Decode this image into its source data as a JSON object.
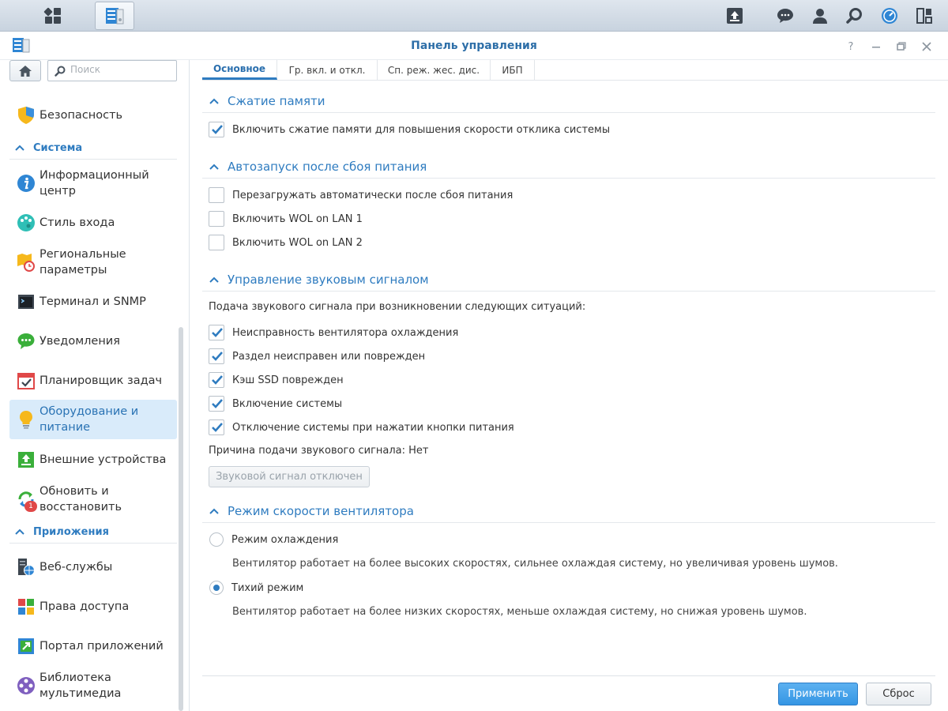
{
  "window": {
    "title": "Панель управления"
  },
  "sidebar": {
    "search_placeholder": "Поиск",
    "items": {
      "security": "Безопасность",
      "info_center": "Информационный\nцентр",
      "login_style": "Стиль входа",
      "regional": "Региональные\nпараметры",
      "terminal": "Терминал и SNMP",
      "notifications": "Уведомления",
      "task_scheduler": "Планировщик задач",
      "hardware": "Оборудование и\nпитание",
      "external_devices": "Внешние устройства",
      "update_restore": "Обновить и\nвосстановить",
      "web_services": "Веб-службы",
      "privileges": "Права доступа",
      "app_portal": "Портал приложений",
      "media_library": "Библиотека\nмультимедиа"
    },
    "groups": {
      "system": "Система",
      "apps": "Приложения"
    },
    "update_badge": "1"
  },
  "tabs": [
    "Основное",
    "Гр. вкл. и откл.",
    "Сп. реж. жес. дис.",
    "ИБП"
  ],
  "sections": {
    "memory": {
      "title": "Сжатие памяти",
      "opt1": "Включить сжатие памяти для повышения скорости отклика системы"
    },
    "autostart": {
      "title": "Автозапуск после сбоя питания",
      "opt1": "Перезагружать автоматически после сбоя питания",
      "opt2": "Включить WOL on LAN 1",
      "opt3": "Включить WOL on LAN 2"
    },
    "beep": {
      "title": "Управление звуковым сигналом",
      "intro": "Подача звукового сигнала при возникновении следующих ситуаций:",
      "opt1": "Неисправность вентилятора охлаждения",
      "opt2": "Раздел неисправен или поврежден",
      "opt3": "Кэш SSD поврежден",
      "opt4": "Включение системы",
      "opt5": "Отключение системы при нажатии кнопки питания",
      "reason": "Причина подачи звукового сигнала: Нет",
      "mute_button": "Звуковой сигнал отключен"
    },
    "fan": {
      "title": "Режим скорости вентилятора",
      "cool_label": "Режим охлаждения",
      "cool_desc": "Вентилятор работает на более высоких скоростях, сильнее охлаждая систему, но увеличивая уровень шумов.",
      "quiet_label": "Тихий режим",
      "quiet_desc": "Вентилятор работает на более низких скоростях, меньше охлаждая систему, но снижая уровень шумов."
    }
  },
  "footer": {
    "apply": "Применить",
    "reset": "Сброс"
  },
  "colors": {
    "accent": "#2f7cc0",
    "selected_bg": "#d9ebfa",
    "apply_bg": "#3596e4"
  }
}
